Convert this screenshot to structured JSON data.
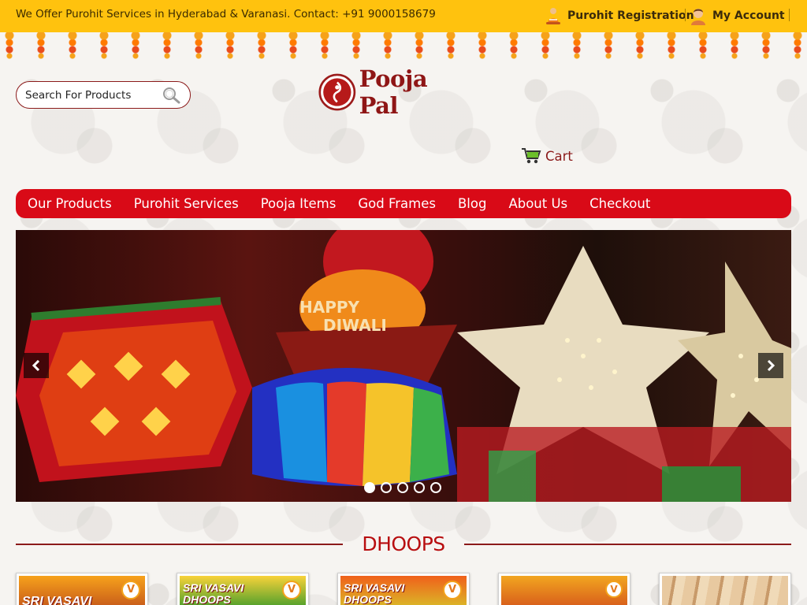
{
  "topbar": {
    "contact_text": "We Offer Purohit Services in Hyderabad & Varanasi. Contact: +91 9000158679",
    "purohit_registration": "Purohit Registration",
    "my_account": "My Account",
    "purohit_icon": "purohit-icon",
    "account_icon": "user-avatar-icon"
  },
  "header": {
    "search_placeholder": "Search For Products",
    "logo_text": "Pooja Pal",
    "cart_label": "Cart"
  },
  "nav": {
    "items": [
      "Our Products",
      "Purohit Services",
      "Pooja Items",
      "God Frames",
      "Blog",
      "About Us",
      "Checkout"
    ]
  },
  "banner": {
    "slide_count": 5,
    "active_slide": 1,
    "lantern_text_1": "HAPPY",
    "lantern_text_2": "DIWALI"
  },
  "section": {
    "title": "DHOOPS"
  },
  "products": [
    {
      "brand": "SRI VASAVI"
    },
    {
      "brand": "SRI VASAVI DHOOPS"
    },
    {
      "brand": "SRI VASAVI DHOOPS"
    },
    {
      "brand": ""
    },
    {
      "brand": ""
    }
  ],
  "colors": {
    "topbar": "#ffc20e",
    "nav": "#d90a17",
    "brand_red": "#8f1616",
    "title_red": "#b80e10"
  }
}
